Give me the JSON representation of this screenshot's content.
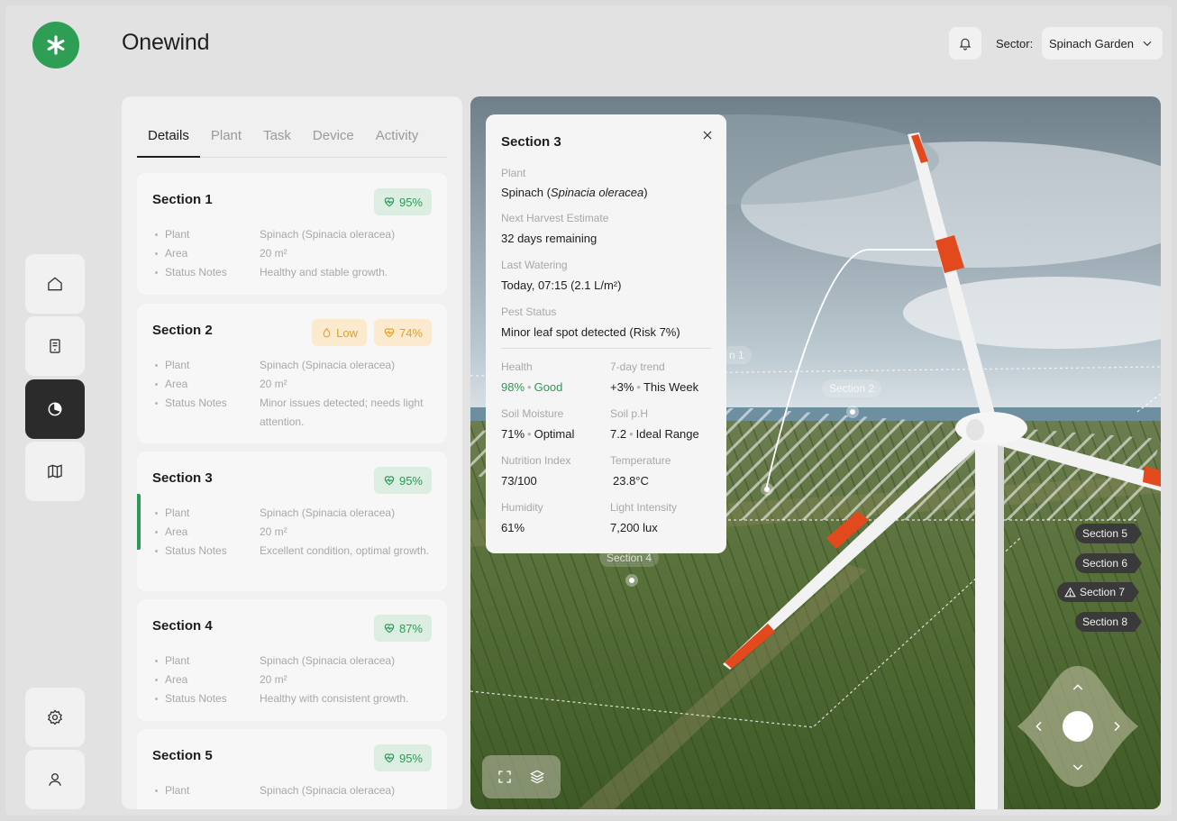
{
  "app": {
    "title": "Onewind"
  },
  "header": {
    "sector_label": "Sector:",
    "sector_value": "Spinach Garden"
  },
  "sidebar": {
    "items": [
      {
        "name": "home",
        "icon": "home-icon"
      },
      {
        "name": "reports",
        "icon": "document-icon"
      },
      {
        "name": "analytics",
        "icon": "pie-chart-icon",
        "active": true
      },
      {
        "name": "map",
        "icon": "map-icon"
      }
    ],
    "bottom": [
      {
        "name": "settings",
        "icon": "gear-icon"
      },
      {
        "name": "profile",
        "icon": "user-icon"
      }
    ]
  },
  "tabs": [
    "Details",
    "Plant",
    "Task",
    "Device",
    "Activity"
  ],
  "field_labels": {
    "plant": "Plant",
    "area": "Area",
    "notes": "Status Notes"
  },
  "sections": [
    {
      "title": "Section 1",
      "plant": "Spinach (Spinacia oleracea)",
      "area": "20 m²",
      "notes": "Healthy and stable growth.",
      "health": "95%"
    },
    {
      "title": "Section 2",
      "plant": "Spinach (Spinacia oleracea)",
      "area": "20 m²",
      "notes": "Minor issues detected; needs light attention.",
      "water": "Low",
      "health": "74%"
    },
    {
      "title": "Section 3",
      "plant": "Spinach (Spinacia oleracea)",
      "area": "20 m²",
      "notes": "Excellent condition, optimal growth.",
      "health": "95%"
    },
    {
      "title": "Section 4",
      "plant": "Spinach (Spinacia oleracea)",
      "area": "20 m²",
      "notes": "Healthy with consistent growth.",
      "health": "87%"
    },
    {
      "title": "Section 5",
      "plant": "Spinach (Spinacia oleracea)",
      "health": "95%"
    }
  ],
  "popup": {
    "title": "Section 3",
    "plant_label": "Plant",
    "plant_common": "Spinach (",
    "plant_latin": "Spinacia oleracea",
    "plant_close": ")",
    "harvest_label": "Next Harvest Estimate",
    "harvest_value": "32 days remaining",
    "watering_label": "Last Watering",
    "watering_value": "Today, 07:15 (2.1 L/m²)",
    "pest_label": "Pest Status",
    "pest_value": "Minor leaf spot detected (Risk 7%)",
    "grid": [
      {
        "label": "Health",
        "value": "98%",
        "extra": "Good",
        "green": true
      },
      {
        "label": "7-day trend",
        "value": "+3%",
        "extra": "This Week"
      },
      {
        "label": "Soil Moisture",
        "value": "71%",
        "extra": "Optimal"
      },
      {
        "label": "Soil p.H",
        "value": "7.2",
        "extra": "Ideal Range"
      },
      {
        "label": "Nutrition Index",
        "value": "73/100"
      },
      {
        "label": "Temperature",
        "value": "23.8°C"
      },
      {
        "label": "Humidity",
        "value": "61%"
      },
      {
        "label": "Light Intensity",
        "value": "7,200 lux"
      }
    ]
  },
  "map": {
    "labels": [
      {
        "text": "n 1"
      },
      {
        "text": "Section 2"
      },
      {
        "text": "Section 4"
      }
    ],
    "pills": [
      "Section 5",
      "Section 6",
      "Section 7",
      "Section 8"
    ],
    "warning_pill": "Section 7"
  },
  "colors": {
    "accent": "#2f9e55",
    "health_green": "#2c9a55",
    "warning_orange": "#e7a11d",
    "dark": "#2b2b2b"
  }
}
